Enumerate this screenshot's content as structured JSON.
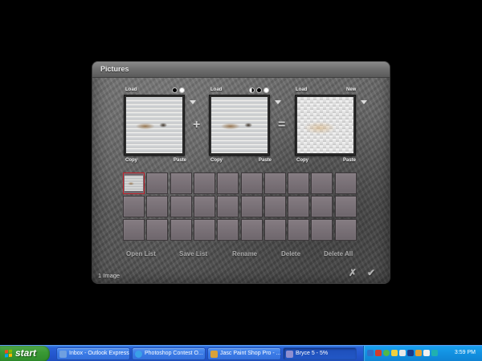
{
  "dialog": {
    "title": "Pictures",
    "status": "1 Image",
    "accept_icon": "check-icon",
    "cancel_icon": "x-icon"
  },
  "slots": [
    {
      "top_label": "Load",
      "copy_label": "Copy",
      "paste_label": "Paste",
      "image": "ocean-wave"
    },
    {
      "top_label": "Load",
      "copy_label": "Copy",
      "paste_label": "Paste",
      "image": "ocean-wave"
    },
    {
      "top_label": "Load",
      "top_right_label": "New",
      "copy_label": "Copy",
      "paste_label": "Paste",
      "image": "checkerboard-result"
    }
  ],
  "operators": [
    "+",
    "="
  ],
  "list_buttons": [
    "Open List",
    "Save List",
    "Rename",
    "Delete",
    "Delete All"
  ],
  "grid": {
    "rows": 3,
    "columns": 10,
    "selected_index": 0
  },
  "taskbar": {
    "start_label": "start",
    "tasks": [
      {
        "label": "Inbox - Outlook Express",
        "icon": "outlook-icon",
        "color": "#6fa0e0"
      },
      {
        "label": "Photoshop Contest O...",
        "icon": "ie-icon",
        "color": "#3aa0e8"
      },
      {
        "label": "Jasc Paint Shop Pro - ...",
        "icon": "psp-icon",
        "color": "#d9a23a"
      },
      {
        "label": "Bryce 5 - 5%",
        "icon": "bryce-icon",
        "color": "#8f8fd0"
      }
    ],
    "tray_icons": [
      "network-icon",
      "shield-icon",
      "msn-icon",
      "volume-icon",
      "antivirus-icon",
      "printer-icon",
      "update-icon",
      "clipboard-icon",
      "misc-icon"
    ],
    "clock": "3:59 PM"
  }
}
